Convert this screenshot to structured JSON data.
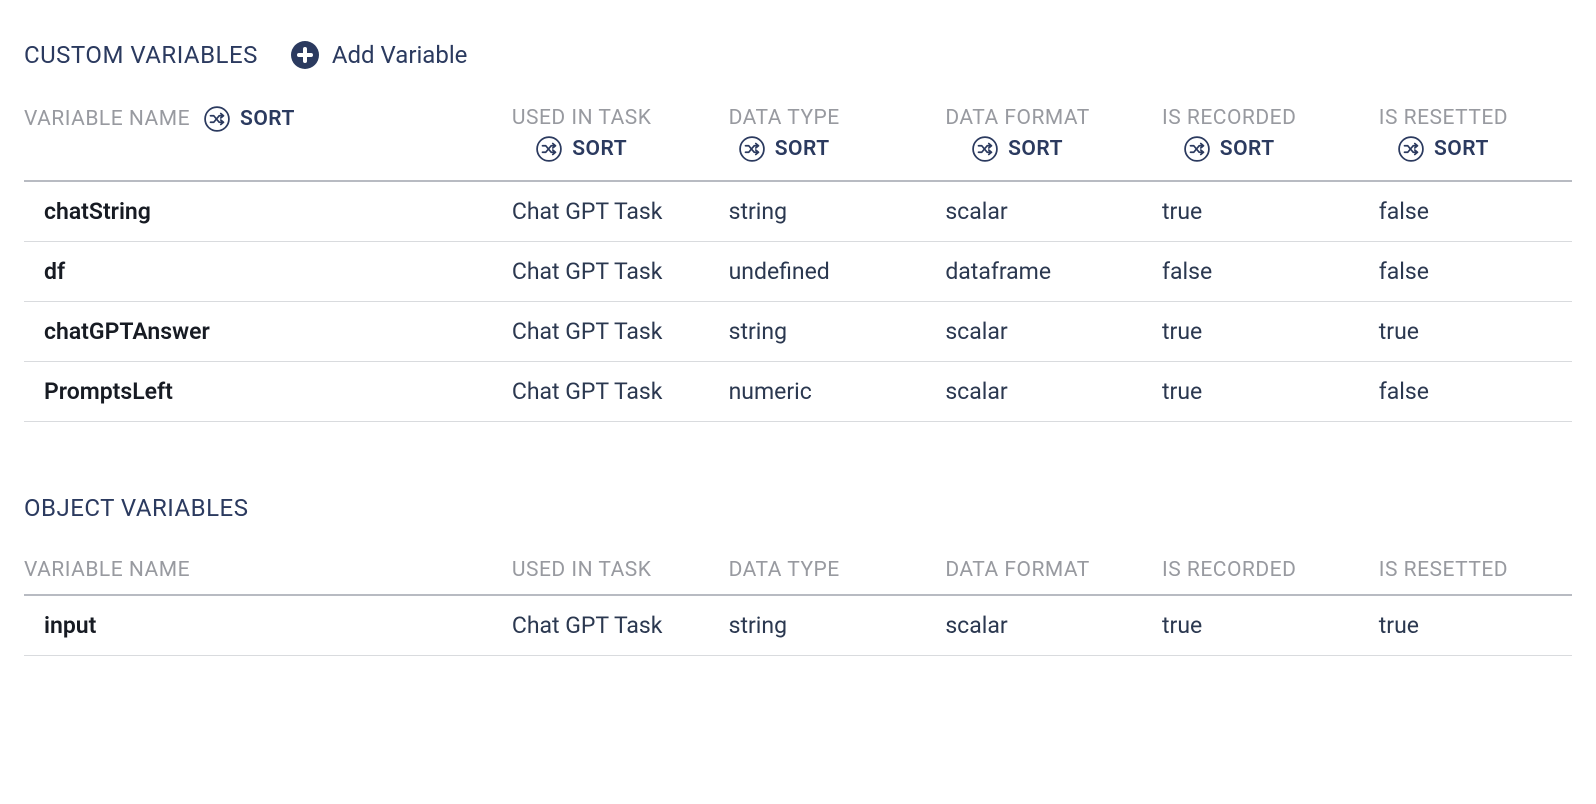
{
  "labels": {
    "sort": "SORT",
    "addVariable": "Add Variable"
  },
  "sections": {
    "custom": {
      "title": "CUSTOM VARIABLES",
      "columns": [
        "VARIABLE NAME",
        "USED IN TASK",
        "DATA TYPE",
        "DATA FORMAT",
        "IS RECORDED",
        "IS RESETTED"
      ],
      "rows": [
        {
          "name": "chatString",
          "task": "Chat GPT Task",
          "type": "string",
          "format": "scalar",
          "recorded": "true",
          "resetted": "false"
        },
        {
          "name": "df",
          "task": "Chat GPT Task",
          "type": "undefined",
          "format": "dataframe",
          "recorded": "false",
          "resetted": "false"
        },
        {
          "name": "chatGPTAnswer",
          "task": "Chat GPT Task",
          "type": "string",
          "format": "scalar",
          "recorded": "true",
          "resetted": "true"
        },
        {
          "name": "PromptsLeft",
          "task": "Chat GPT Task",
          "type": "numeric",
          "format": "scalar",
          "recorded": "true",
          "resetted": "false"
        }
      ]
    },
    "object": {
      "title": "OBJECT VARIABLES",
      "columns": [
        "VARIABLE NAME",
        "USED IN TASK",
        "DATA TYPE",
        "DATA FORMAT",
        "IS RECORDED",
        "IS RESETTED"
      ],
      "rows": [
        {
          "name": "input",
          "task": "Chat GPT Task",
          "type": "string",
          "format": "scalar",
          "recorded": "true",
          "resetted": "true"
        }
      ]
    }
  }
}
